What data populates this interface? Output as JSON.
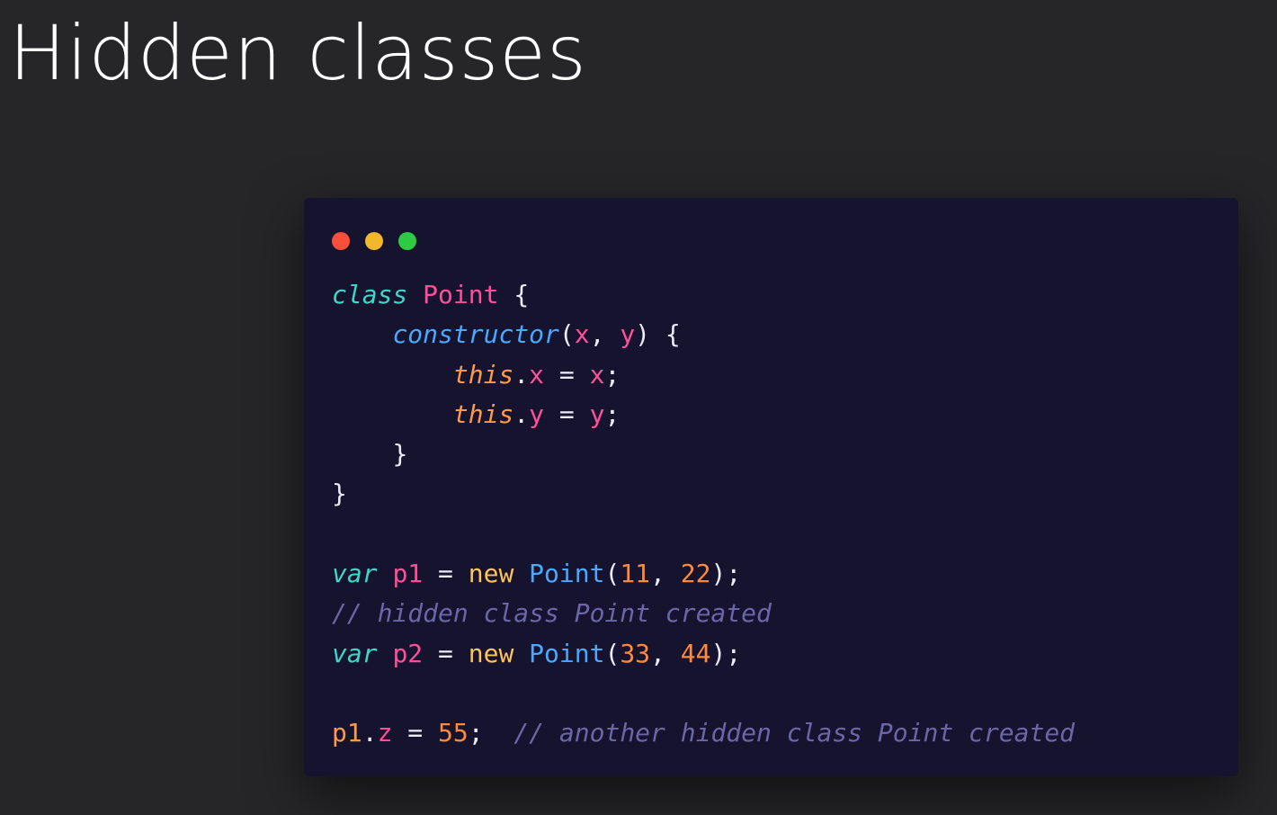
{
  "slide": {
    "title": "Hidden classes"
  },
  "window": {
    "buttons": [
      "close",
      "minimize",
      "zoom"
    ]
  },
  "code": {
    "l1": {
      "kw": "class",
      "name": "Point",
      "brace": "{"
    },
    "l2": {
      "fn": "constructor",
      "open": "(",
      "a": "x",
      "comma": ",",
      "b": "y",
      "close": ")",
      "brace": "{"
    },
    "l3": {
      "this": "this",
      "dot": ".",
      "prop": "x",
      "eq": "=",
      "val": "x",
      "semi": ";"
    },
    "l4": {
      "this": "this",
      "dot": ".",
      "prop": "y",
      "eq": "=",
      "val": "y",
      "semi": ";"
    },
    "l5": {
      "brace": "}"
    },
    "l6": {
      "brace": "}"
    },
    "l8": {
      "kw": "var",
      "name": "p1",
      "eq": "=",
      "new": "new",
      "ctor": "Point",
      "open": "(",
      "n1": "11",
      "comma": ",",
      "n2": "22",
      "close": ");"
    },
    "l9": {
      "comment": "// hidden class Point created"
    },
    "l10": {
      "kw": "var",
      "name": "p2",
      "eq": "=",
      "new": "new",
      "ctor": "Point",
      "open": "(",
      "n1": "33",
      "comma": ",",
      "n2": "44",
      "close": ");"
    },
    "l12": {
      "obj": "p1",
      "dot": ".",
      "prop": "z",
      "eq": "=",
      "val": "55",
      "semi": ";",
      "comment": "// another hidden class Point created"
    }
  },
  "colors": {
    "background": "#262628",
    "editor": "#16132e",
    "close": "#fb4e3b",
    "minimize": "#f0b82a",
    "zoom": "#2ccb43"
  }
}
